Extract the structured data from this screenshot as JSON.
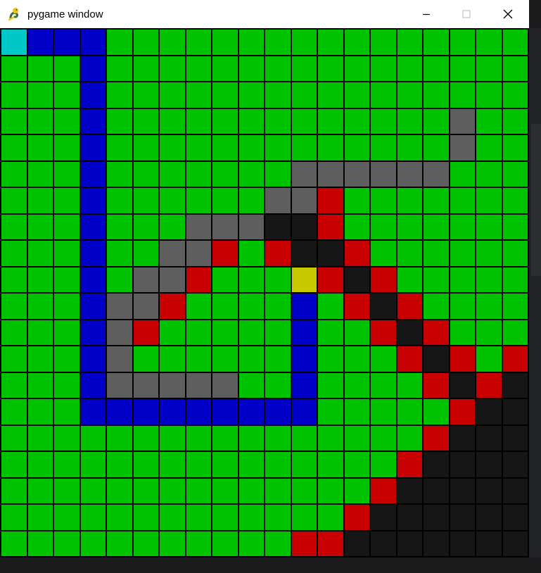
{
  "window": {
    "title": "pygame window",
    "icon": "pygame-snake-icon",
    "controls": [
      "minimize-icon",
      "maximize-icon",
      "close-icon"
    ]
  },
  "palette": {
    "g": "#00c300",
    "b": "#0000c8",
    "c": "#00c8c8",
    "x": "#5e5e5e",
    "r": "#c80000",
    "k": "#161616",
    "y": "#c8c800"
  },
  "legend": {
    "g": "open-cell",
    "b": "path-cell",
    "c": "start-cell",
    "x": "wall-cell",
    "r": "frontier-cell",
    "k": "visited-cell",
    "y": "end-cell"
  },
  "grid": {
    "rows": 20,
    "cols": 20,
    "cells": [
      "cbbbgggggggggggggggg",
      "gggbgggggggggggggggg",
      "gggbgggggggggggggggg",
      "gggbgggggggggggggxgg",
      "gggbgggggggggggggxgg",
      "gggbgggggggxxxxxxggg",
      "gggbggggggxxrggggggg",
      "gggbgggxxxkkrggggggg",
      "gggbggxxrgrkkrgggggg",
      "gggbgxxrgggyrkrggggg",
      "gggbxxrggggbgrkrgggg",
      "gggbxrgggggbggrkrggg",
      "gggbxggggggbgggrkrgr",
      "gggbxxxxxggbggggrkrk",
      "gggbbbbbbbbbgggggrkk",
      "ggggggggggggggggrkkk",
      "gggggggggggggggrkkkk",
      "ggggggggggggggrkkkkk",
      "gggggggggggggrkkkkkk",
      "gggggggggggrrkkkkkkk"
    ]
  }
}
